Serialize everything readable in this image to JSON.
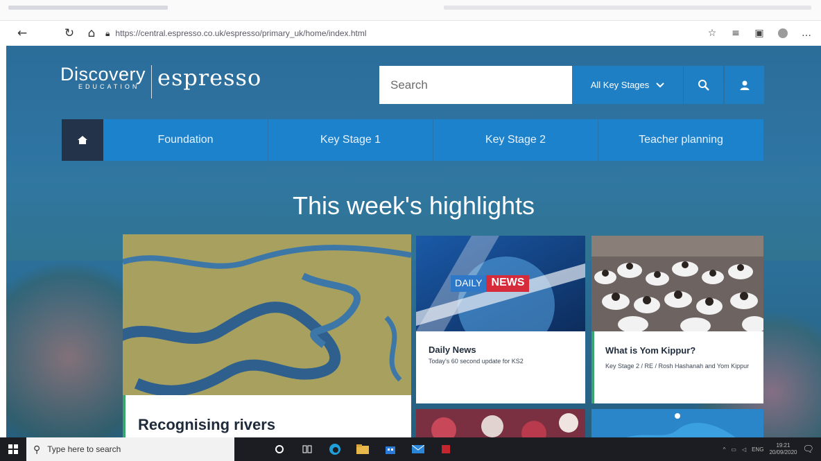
{
  "browser": {
    "url": "https://central.espresso.co.uk/espresso/primary_uk/home/index.html"
  },
  "logo": {
    "discovery": "Discovery",
    "education": "EDUCATION",
    "espresso": "espresso"
  },
  "search": {
    "placeholder": "Search",
    "key_stage_selected": "All Key Stages"
  },
  "nav": {
    "items": [
      {
        "label": "Foundation"
      },
      {
        "label": "Key Stage 1"
      },
      {
        "label": "Key Stage 2"
      },
      {
        "label": "Teacher planning"
      }
    ]
  },
  "highlights": {
    "title": "This week's highlights",
    "cards": [
      {
        "title": "Recognising rivers"
      },
      {
        "title": "Daily News",
        "subtitle": "Today's 60 second update for KS2",
        "badge_daily": "DAILY",
        "badge_news": "NEWS"
      },
      {
        "title": "What is Yom Kippur?",
        "subtitle": "Key Stage 2 / RE / Rosh Hashanah and Yom Kippur"
      }
    ]
  },
  "taskbar": {
    "search_placeholder": "Type here to search",
    "tray_lang": "ENG",
    "time": "19:21",
    "date": "20/09/2020"
  },
  "colors": {
    "nav_blue": "#1c82cc",
    "home_dark": "#23334a",
    "accent_green": "#3aa66d",
    "news_red": "#d62b3b"
  }
}
